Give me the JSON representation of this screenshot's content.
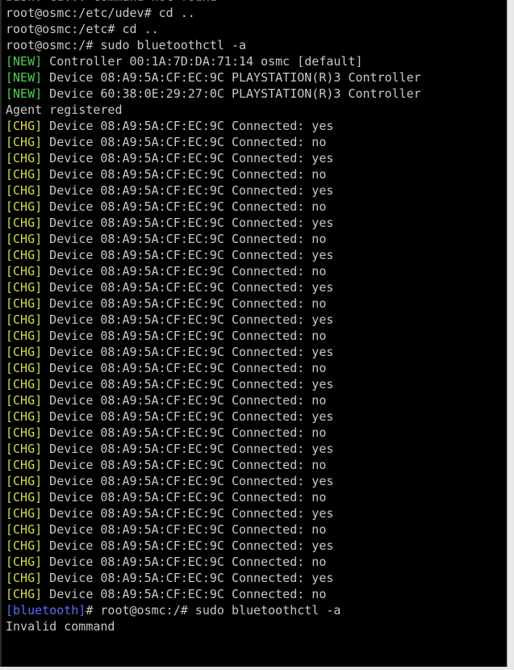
{
  "terminal": {
    "colors": {
      "background": "#000000",
      "text": "#c8c8c8",
      "new_tag": "#4bd24b",
      "chg_tag": "#d9d94a",
      "bluetooth_prompt": "#5a6cff"
    },
    "lines": [
      {
        "type": "plain",
        "text": "bash: cd..: command not found"
      },
      {
        "type": "plain",
        "text": "root@osmc:/etc/udev# cd .."
      },
      {
        "type": "plain",
        "text": "root@osmc:/etc# cd .."
      },
      {
        "type": "plain",
        "text": "root@osmc:/# sudo bluetoothctl -a"
      },
      {
        "type": "tagged",
        "tag": "[NEW]",
        "tagclass": "new",
        "text": " Controller 00:1A:7D:DA:71:14 osmc [default]"
      },
      {
        "type": "tagged",
        "tag": "[NEW]",
        "tagclass": "new",
        "text": " Device 08:A9:5A:CF:EC:9C PLAYSTATION(R)3 Controller"
      },
      {
        "type": "tagged",
        "tag": "[NEW]",
        "tagclass": "new",
        "text": " Device 60:38:0E:29:27:0C PLAYSTATION(R)3 Controller"
      },
      {
        "type": "plain",
        "text": "Agent registered"
      },
      {
        "type": "tagged",
        "tag": "[CHG]",
        "tagclass": "chg",
        "text": " Device 08:A9:5A:CF:EC:9C Connected: yes"
      },
      {
        "type": "tagged",
        "tag": "[CHG]",
        "tagclass": "chg",
        "text": " Device 08:A9:5A:CF:EC:9C Connected: no"
      },
      {
        "type": "tagged",
        "tag": "[CHG]",
        "tagclass": "chg",
        "text": " Device 08:A9:5A:CF:EC:9C Connected: yes"
      },
      {
        "type": "tagged",
        "tag": "[CHG]",
        "tagclass": "chg",
        "text": " Device 08:A9:5A:CF:EC:9C Connected: no"
      },
      {
        "type": "tagged",
        "tag": "[CHG]",
        "tagclass": "chg",
        "text": " Device 08:A9:5A:CF:EC:9C Connected: yes"
      },
      {
        "type": "tagged",
        "tag": "[CHG]",
        "tagclass": "chg",
        "text": " Device 08:A9:5A:CF:EC:9C Connected: no"
      },
      {
        "type": "tagged",
        "tag": "[CHG]",
        "tagclass": "chg",
        "text": " Device 08:A9:5A:CF:EC:9C Connected: yes"
      },
      {
        "type": "tagged",
        "tag": "[CHG]",
        "tagclass": "chg",
        "text": " Device 08:A9:5A:CF:EC:9C Connected: no"
      },
      {
        "type": "tagged",
        "tag": "[CHG]",
        "tagclass": "chg",
        "text": " Device 08:A9:5A:CF:EC:9C Connected: yes"
      },
      {
        "type": "tagged",
        "tag": "[CHG]",
        "tagclass": "chg",
        "text": " Device 08:A9:5A:CF:EC:9C Connected: no"
      },
      {
        "type": "tagged",
        "tag": "[CHG]",
        "tagclass": "chg",
        "text": " Device 08:A9:5A:CF:EC:9C Connected: yes"
      },
      {
        "type": "tagged",
        "tag": "[CHG]",
        "tagclass": "chg",
        "text": " Device 08:A9:5A:CF:EC:9C Connected: no"
      },
      {
        "type": "tagged",
        "tag": "[CHG]",
        "tagclass": "chg",
        "text": " Device 08:A9:5A:CF:EC:9C Connected: yes"
      },
      {
        "type": "tagged",
        "tag": "[CHG]",
        "tagclass": "chg",
        "text": " Device 08:A9:5A:CF:EC:9C Connected: no"
      },
      {
        "type": "tagged",
        "tag": "[CHG]",
        "tagclass": "chg",
        "text": " Device 08:A9:5A:CF:EC:9C Connected: yes"
      },
      {
        "type": "tagged",
        "tag": "[CHG]",
        "tagclass": "chg",
        "text": " Device 08:A9:5A:CF:EC:9C Connected: no"
      },
      {
        "type": "tagged",
        "tag": "[CHG]",
        "tagclass": "chg",
        "text": " Device 08:A9:5A:CF:EC:9C Connected: yes"
      },
      {
        "type": "tagged",
        "tag": "[CHG]",
        "tagclass": "chg",
        "text": " Device 08:A9:5A:CF:EC:9C Connected: no"
      },
      {
        "type": "tagged",
        "tag": "[CHG]",
        "tagclass": "chg",
        "text": " Device 08:A9:5A:CF:EC:9C Connected: yes"
      },
      {
        "type": "tagged",
        "tag": "[CHG]",
        "tagclass": "chg",
        "text": " Device 08:A9:5A:CF:EC:9C Connected: no"
      },
      {
        "type": "tagged",
        "tag": "[CHG]",
        "tagclass": "chg",
        "text": " Device 08:A9:5A:CF:EC:9C Connected: yes"
      },
      {
        "type": "tagged",
        "tag": "[CHG]",
        "tagclass": "chg",
        "text": " Device 08:A9:5A:CF:EC:9C Connected: no"
      },
      {
        "type": "tagged",
        "tag": "[CHG]",
        "tagclass": "chg",
        "text": " Device 08:A9:5A:CF:EC:9C Connected: yes"
      },
      {
        "type": "tagged",
        "tag": "[CHG]",
        "tagclass": "chg",
        "text": " Device 08:A9:5A:CF:EC:9C Connected: no"
      },
      {
        "type": "tagged",
        "tag": "[CHG]",
        "tagclass": "chg",
        "text": " Device 08:A9:5A:CF:EC:9C Connected: yes"
      },
      {
        "type": "tagged",
        "tag": "[CHG]",
        "tagclass": "chg",
        "text": " Device 08:A9:5A:CF:EC:9C Connected: no"
      },
      {
        "type": "tagged",
        "tag": "[CHG]",
        "tagclass": "chg",
        "text": " Device 08:A9:5A:CF:EC:9C Connected: yes"
      },
      {
        "type": "tagged",
        "tag": "[CHG]",
        "tagclass": "chg",
        "text": " Device 08:A9:5A:CF:EC:9C Connected: no"
      },
      {
        "type": "tagged",
        "tag": "[CHG]",
        "tagclass": "chg",
        "text": " Device 08:A9:5A:CF:EC:9C Connected: yes"
      },
      {
        "type": "tagged",
        "tag": "[CHG]",
        "tagclass": "chg",
        "text": " Device 08:A9:5A:CF:EC:9C Connected: no"
      },
      {
        "type": "tagged",
        "tag": "[bluetooth]",
        "tagclass": "bt",
        "text": "# root@osmc:/# sudo bluetoothctl -a"
      },
      {
        "type": "plain",
        "text": "Invalid command"
      }
    ]
  }
}
